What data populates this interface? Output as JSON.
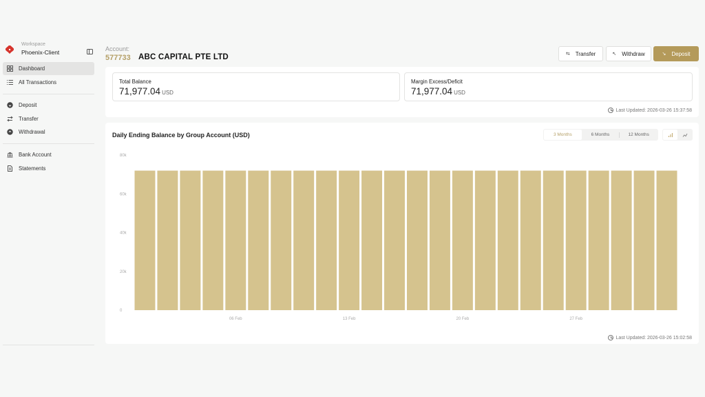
{
  "workspace": {
    "caption": "Workspace",
    "name": "Phoenix-Client"
  },
  "nav": {
    "group1": [
      {
        "label": "Dashboard",
        "icon": "grid-icon",
        "active": true
      },
      {
        "label": "All Transactions",
        "icon": "list-icon"
      }
    ],
    "group2": [
      {
        "label": "Deposit",
        "icon": "arrow-down-circle-icon"
      },
      {
        "label": "Transfer",
        "icon": "swap-icon"
      },
      {
        "label": "Withdrawal",
        "icon": "arrow-up-circle-icon"
      }
    ],
    "group3": [
      {
        "label": "Bank Account",
        "icon": "bank-icon"
      },
      {
        "label": "Statements",
        "icon": "document-icon"
      }
    ]
  },
  "account": {
    "caption": "Account:",
    "number": "577733",
    "name": "ABC CAPITAL PTE LTD"
  },
  "actions": {
    "transfer": "Transfer",
    "withdraw": "Withdraw",
    "deposit": "Deposit"
  },
  "balances": {
    "total": {
      "label": "Total Balance",
      "value": "71,977.04",
      "unit": "USD"
    },
    "margin": {
      "label": "Margin Excess/Deficit",
      "value": "71,977.04",
      "unit": "USD"
    },
    "last_updated": "Last Updated: 2026-03-26 15:37:58"
  },
  "chart_panel": {
    "title": "Daily Ending Balance by Group Account (USD)",
    "ranges": [
      "3 Months",
      "6 Months",
      "12 Months"
    ],
    "active_range": "3 Months",
    "last_updated": "Last Updated: 2026-03-26 15:02:58"
  },
  "colors": {
    "accent": "#b49a5a",
    "bar": "#d5c38e"
  },
  "chart_data": {
    "type": "bar",
    "ylim": [
      0,
      80000
    ],
    "yticks": [
      0,
      20000,
      40000,
      60000,
      80000
    ],
    "ytick_labels": [
      "0",
      "20k",
      "40k",
      "60k",
      "80k"
    ],
    "xtick_labels": [
      {
        "label": "06 Feb",
        "index": 4.5
      },
      {
        "label": "13 Feb",
        "index": 9.5
      },
      {
        "label": "20 Feb",
        "index": 14.5
      },
      {
        "label": "27 Feb",
        "index": 19.5
      }
    ],
    "values": [
      71977.04,
      71977.04,
      71977.04,
      71977.04,
      71977.04,
      71977.04,
      71977.04,
      71977.04,
      71977.04,
      71977.04,
      71977.04,
      71977.04,
      71977.04,
      71977.04,
      71977.04,
      71977.04,
      71977.04,
      71977.04,
      71977.04,
      71977.04,
      71977.04,
      71977.04,
      71977.04,
      71977.04
    ],
    "grid": false,
    "legend": "none"
  }
}
